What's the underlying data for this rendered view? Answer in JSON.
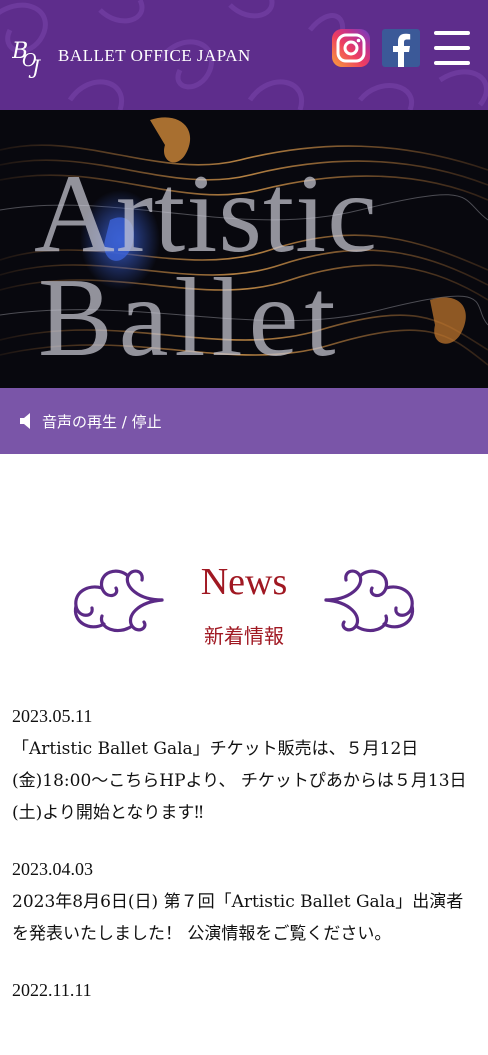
{
  "header": {
    "logo_mark_letters": "BOJ",
    "logo_text": "BALLET OFFICE JAPAN",
    "colors": {
      "background": "#5e2d8c",
      "text": "#ffffff"
    }
  },
  "social": {
    "instagram_icon": "instagram-icon",
    "facebook_icon": "facebook-icon",
    "menu_icon": "hamburger-menu-icon"
  },
  "hero": {
    "title_line1": "Artistic",
    "title_line2": "Ballet"
  },
  "audio": {
    "icon": "speaker-icon",
    "label": "音声の再生 / 停止",
    "color": "#7a55a8"
  },
  "news": {
    "title": "News",
    "subtitle": "新着情報",
    "accent_color": "#a01822",
    "items": [
      {
        "date": "2023.05.11",
        "text": "「Artistic Ballet Gala」チケット販売は、５月12日(金)18:00～こちらHPより、 チケットぴあからは５月13日(土)より開始となります‼"
      },
      {
        "date": "2023.04.03",
        "text": "2023年8月6日(日) 第７回「Artistic Ballet Gala」出演者を発表いたしました！ 公演情報をご覧ください。"
      },
      {
        "date": "2022.11.11",
        "text": ""
      }
    ]
  }
}
